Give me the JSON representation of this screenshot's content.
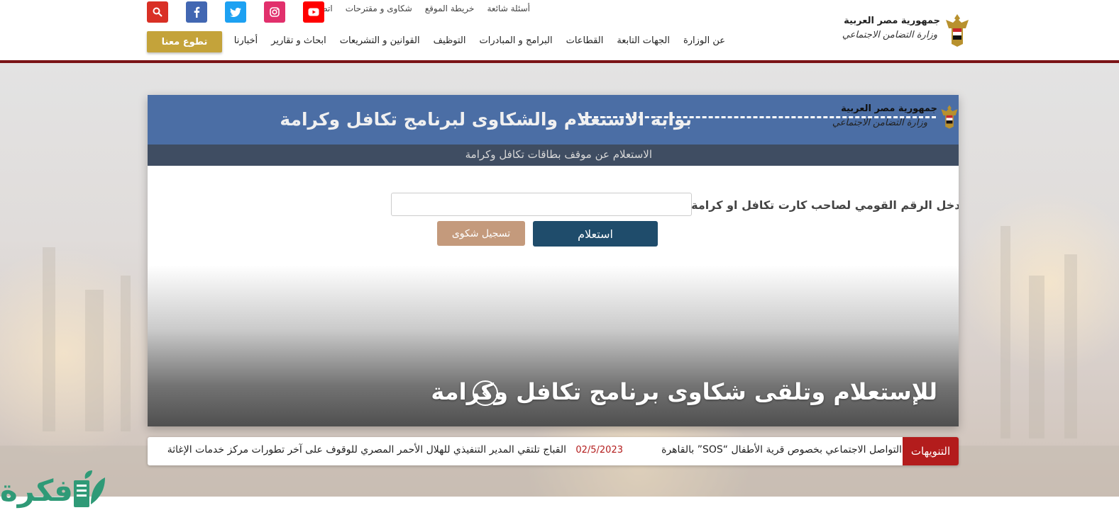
{
  "header": {
    "logo_line1": "جمهورية مصر العربية",
    "logo_line2": "وزارة التضامن الاجتماعي",
    "top_links": [
      "أسئلة شائعة",
      "خريطة الموقع",
      "شكاوى و مقترحات",
      "اتصل بنا"
    ],
    "social": [
      {
        "icon": "search-icon",
        "color": "#d93025"
      },
      {
        "icon": "facebook-icon",
        "color": "#4267b2"
      },
      {
        "icon": "twitter-icon",
        "color": "#1da1f2"
      },
      {
        "icon": "instagram-icon",
        "color": "#e1306c"
      },
      {
        "icon": "youtube-icon",
        "color": "#ff0000"
      }
    ],
    "nav": [
      "عن الوزارة",
      "الجهات التابعة",
      "القطاعات",
      "البرامج و المبادرات",
      "التوظيف",
      "القوانين و التشريعات",
      "ابحاث و تقارير",
      "أخبارنا"
    ],
    "volunteer_label": "تطوع معنا",
    "accent_color": "#7a1416"
  },
  "panel": {
    "logo_line1": "جمهورية مصر العربية",
    "logo_line2": "وزارة التضامن الاجتماعي",
    "title": "بوابة الاستعلام والشكاوى لبرنامج تكافل وكرامة",
    "subtitle": "الاستعلام عن موقف بطاقات تكافل وكرامة",
    "form_label": "ادخل الرقم القومي لصاحب كارت تكافل او كرامة:",
    "input_value": "",
    "input_placeholder": "",
    "query_button": "استعلام",
    "complaint_button": "تسجيل شكوى",
    "slide_caption": "للإستعلام وتلقى شكاوى برنامج تكافل وكرامة"
  },
  "ticker": {
    "label": "التنويهات",
    "item1": "التواصل الاجتماعي بخصوص قرية الأطفال “SOS” بالقاهرة",
    "date2": "02/5/2023",
    "item2": "القباج تلتقي المدير التنفيذي للهلال الأحمر المصري للوقوف على آخر تطورات مركز خدمات الإغاثة"
  },
  "watermark": {
    "text": "فكرة"
  }
}
